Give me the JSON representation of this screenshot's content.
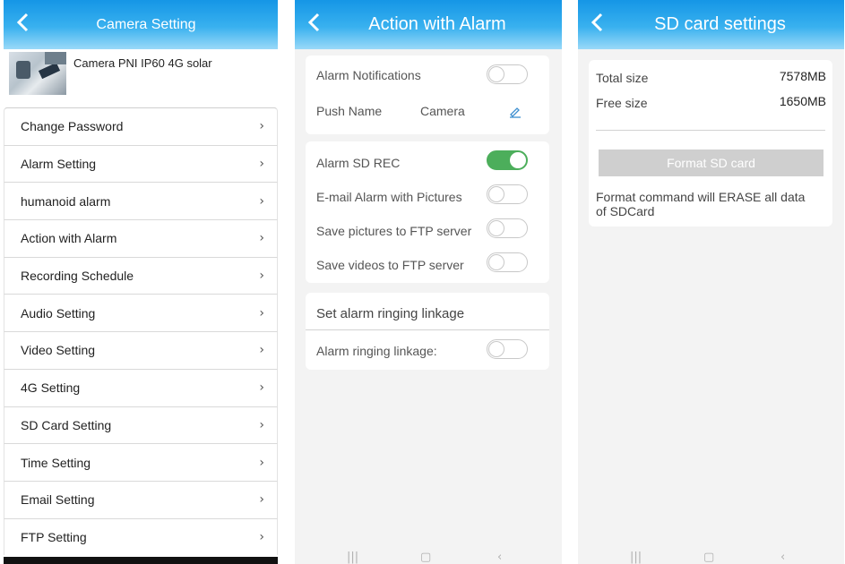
{
  "panel1": {
    "title": "Camera Setting",
    "camera_name": "Camera PNI IP60 4G solar",
    "menu": [
      "Change Password",
      "Alarm Setting",
      "humanoid alarm",
      "Action with Alarm",
      "Recording Schedule",
      "Audio Setting",
      "Video Setting",
      "4G Setting",
      "SD Card Setting",
      "Time Setting",
      "Email Setting",
      "FTP Setting"
    ],
    "chevron": "›"
  },
  "panel2": {
    "title": "Action with Alarm",
    "alarm_notifications": {
      "label": "Alarm Notifications",
      "on": false
    },
    "push_name": {
      "label": "Push Name",
      "value": "Camera"
    },
    "alarm_sd_rec": {
      "label": "Alarm SD REC",
      "on": true
    },
    "email_alarm": {
      "label": "E-mail Alarm with Pictures",
      "on": false
    },
    "ftp_pictures": {
      "label": "Save pictures to FTP server",
      "on": false
    },
    "ftp_videos": {
      "label": "Save videos to FTP server",
      "on": false
    },
    "ringing_header": "Set alarm ringing linkage",
    "ringing_linkage": {
      "label": "Alarm ringing linkage:",
      "on": false
    }
  },
  "panel3": {
    "title": "SD card settings",
    "total_label": "Total size",
    "total_value": "7578MB",
    "free_label": "Free size",
    "free_value": "1650MB",
    "format_button": "Format SD card",
    "note": "Format command will ERASE all data of SDCard"
  },
  "navbar": {
    "recents": "|||",
    "home": "▢",
    "back": "‹"
  },
  "colors": {
    "header_top": "#1596e6",
    "header_bottom": "#9ad9f8",
    "toggle_on": "#4cae5b",
    "format_button": "#cfcfcf"
  }
}
